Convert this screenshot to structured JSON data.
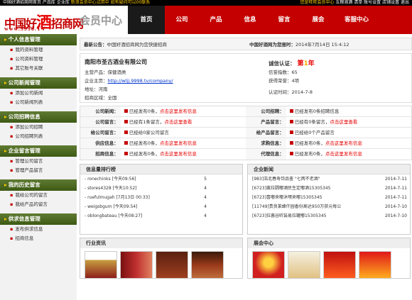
{
  "topbar": {
    "left_text": "中国好酒招商网首页  产品库  企业库",
    "left_highlight": "  新浪会员中心试用中  如有疑问可以00联系",
    "right_highlight": "您是旺旺会员中心",
    "right_text": "  五粮液酒  清单  账号设置  店铺设置  退出"
  },
  "logo": {
    "cn": "中国好",
    "big": "酒",
    "cn2": "招商网",
    "sub": "www.9998.TV",
    "member_center": "会员中心"
  },
  "nav": [
    "首页",
    "公司",
    "产品",
    "信息",
    "留言",
    "展会",
    "客服中心"
  ],
  "sidebar": [
    {
      "title": "个人信息管理",
      "items": [
        "我的资料管理",
        "公司资料管理",
        "其它账号关联"
      ]
    },
    {
      "title": "公司新闻管理",
      "items": [
        "添加公司新闻",
        "公司新闻列表"
      ]
    },
    {
      "title": "公司招聘信息",
      "items": [
        "添加公司招聘",
        "公司招聘列表"
      ]
    },
    {
      "title": "企业留言管理",
      "items": [
        "管理公司留言",
        "管理产品留言"
      ]
    },
    {
      "title": "我的历史留言",
      "items": [
        "我给公司的留言",
        "我给产品的留言"
      ]
    },
    {
      "title": "供求信息管理",
      "items": [
        "发布供求信息",
        "招商信息"
      ]
    }
  ],
  "welcome": {
    "label": "最新公告：",
    "text": "中国好酒招商网为您快捷招商",
    "time_label": "中国好酒网为您报时：",
    "time": "2014年7月14日  15:4:12"
  },
  "company": {
    "name": "南阳市圣古酒业有限公司",
    "main_product_label": "主营产品：",
    "main_product": "保健酒类",
    "site_label": "企业主页：",
    "site": "http://wljj.9998.tv/company/",
    "address_label": "地址：",
    "address": "河南",
    "area_label": "招商区域：",
    "area": "全国",
    "cert_label": "诚信认证：",
    "cert_year": "第",
    "cert_num": "1",
    "cert_unit": "年",
    "credit": "信誉指数：65",
    "honor": "获得荣誉：4项",
    "cert_date": "认证时间：2014-7-8"
  },
  "stats": [
    {
      "k1": "公司新闻：",
      "v1a": "已经发布0条，",
      "v1b": "点击这里发布信息",
      "k2": "公司招聘：",
      "v2a": "已经发布0条招聘信息",
      "v2b": ""
    },
    {
      "k1": "公司留言：",
      "v1a": "已经有1条留言，",
      "v1b": "点击这里查看",
      "k2": "产品留言：",
      "v2a": "已经有0条留言，",
      "v2b": "点击这里查看"
    },
    {
      "k1": "给公司留言：",
      "v1a": "已经给0家公司留言",
      "v1b": "",
      "k2": "给产品留言：",
      "v2a": "已经给0个产品留言",
      "v2b": ""
    },
    {
      "k1": "供应信息：",
      "v1a": "已经发布0条，",
      "v1b": "点击这里发布信息",
      "k2": "求购信息：",
      "v2a": "已经发布0条，",
      "v2b": "点击这里发布信息"
    },
    {
      "k1": "招商信息：",
      "v1a": "已经发布0条，",
      "v1b": "点击这里发布信息",
      "k2": "代理信息：",
      "v2a": "已经发布0条，",
      "v2b": "点击这里发布信息"
    }
  ],
  "rank_panel": {
    "title": "信息量排行榜",
    "rows": [
      {
        "name": "- ronechinks  [今天09:56]",
        "num": "5"
      },
      {
        "name": "- stores4328  [今天10:52]",
        "num": "4"
      },
      {
        "name": "- ruefulmugah  [7月13日 00:33]",
        "num": "4"
      },
      {
        "name": "- weigsbgum  [今天09:54]",
        "num": "4"
      },
      {
        "name": "- oblongbateau  [今天08:27]",
        "num": "4"
      }
    ]
  },
  "news_panel": {
    "title": "企业新闻",
    "rows": [
      {
        "name": "[983]浩北春寿岱品鉴 \"七两不老酒\"",
        "date": "2014-7-11"
      },
      {
        "name": "[6723]酱拉闘嘟酒民生定嘟酒15305345",
        "date": "2014-7-11"
      },
      {
        "name": "[6723]喜嘟来嘟沐嘿来嘟15305345",
        "date": "2014-7-11"
      },
      {
        "name": "[11749]贵良莱蜂仟园香份高达950万获元每公",
        "date": "2014-7-10"
      },
      {
        "name": "[6723]拉酱谷听装易拉罐嘟15305345",
        "date": "2014-7-10"
      }
    ]
  },
  "gallery_left": {
    "title": "行业资讯"
  },
  "gallery_right": {
    "title": "展会中心"
  },
  "colors": {
    "brand_red": "#c40000",
    "sidebar_green": "#4a6620",
    "link_red": "#e60000"
  }
}
